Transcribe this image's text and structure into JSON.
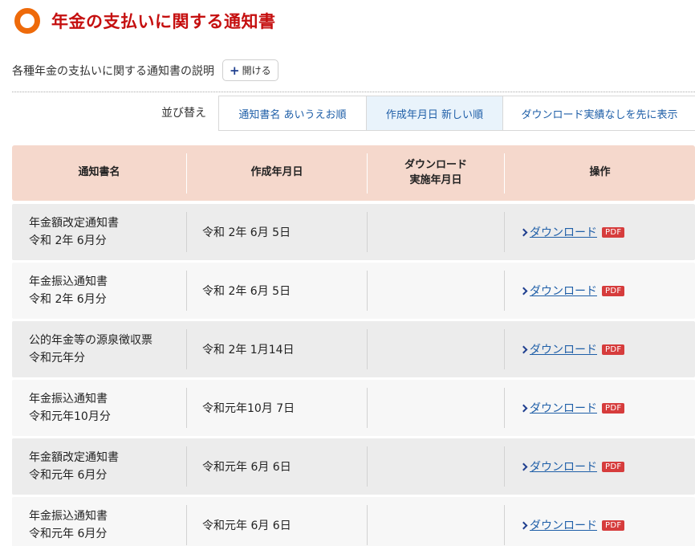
{
  "page": {
    "title": "年金の支払いに関する通知書"
  },
  "explanation": {
    "text": "各種年金の支払いに関する通知書の説明",
    "open_label": "開ける"
  },
  "sort": {
    "label": "並び替え",
    "tabs": [
      {
        "label": "通知書名 あいうえお順",
        "active": false
      },
      {
        "label": "作成年月日 新しい順",
        "active": true
      },
      {
        "label": "ダウンロード実績なしを先に表示",
        "active": false
      }
    ]
  },
  "table": {
    "headers": {
      "name": "通知書名",
      "created": "作成年月日",
      "download_line1": "ダウンロード",
      "download_line2": "実施年月日",
      "action": "操作"
    },
    "rows": [
      {
        "name": "年金額改定通知書",
        "period": "令和 2年 6月分",
        "created": "令和 2年 6月 5日",
        "downloaded": "",
        "link": "ダウンロード",
        "badge": "PDF"
      },
      {
        "name": "年金振込通知書",
        "period": "令和 2年 6月分",
        "created": "令和 2年 6月 5日",
        "downloaded": "",
        "link": "ダウンロード",
        "badge": "PDF"
      },
      {
        "name": "公的年金等の源泉徴収票",
        "period": "令和元年分",
        "created": "令和 2年 1月14日",
        "downloaded": "",
        "link": "ダウンロード",
        "badge": "PDF"
      },
      {
        "name": "年金振込通知書",
        "period": "令和元年10月分",
        "created": "令和元年10月 7日",
        "downloaded": "",
        "link": "ダウンロード",
        "badge": "PDF"
      },
      {
        "name": "年金額改定通知書",
        "period": "令和元年 6月分",
        "created": "令和元年 6月 6日",
        "downloaded": "",
        "link": "ダウンロード",
        "badge": "PDF"
      },
      {
        "name": "年金振込通知書",
        "period": "令和元年 6月分",
        "created": "令和元年 6月 6日",
        "downloaded": "",
        "link": "ダウンロード",
        "badge": "PDF"
      }
    ]
  },
  "colors": {
    "title": "#c50f0f",
    "ring": "#ee6a0a",
    "header_bg": "#f5d8cc",
    "link": "#1f5fa8",
    "pdf_badge": "#d63c3c"
  }
}
